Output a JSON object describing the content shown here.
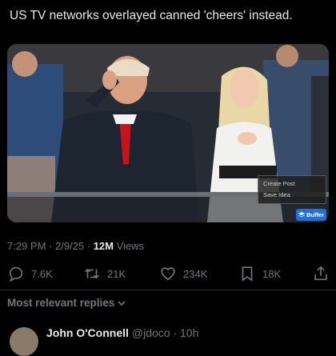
{
  "tweet": {
    "text": "US TV networks overlayed canned 'cheers' instead."
  },
  "media": {
    "overlay_menu": [
      "Create Post",
      "Save Idea"
    ],
    "buffer_button": "Buffer"
  },
  "meta": {
    "time": "7:29 PM",
    "separator1": " · ",
    "date": "2/9/25",
    "separator2": " · ",
    "views_count": "12M",
    "views_label": " Views"
  },
  "actions": {
    "reply_count": "7.6K",
    "repost_count": "21K",
    "like_count": "234K",
    "bookmark_count": "18K"
  },
  "replies": {
    "sort_label": "Most relevant replies",
    "first_reply_author": "John O'Connell",
    "first_reply_handle": "@jdoco · 10h"
  },
  "colors": {
    "background": "#000000",
    "text": "#e7e9ea",
    "muted": "#71767b",
    "buffer": "#1d6fe6"
  }
}
